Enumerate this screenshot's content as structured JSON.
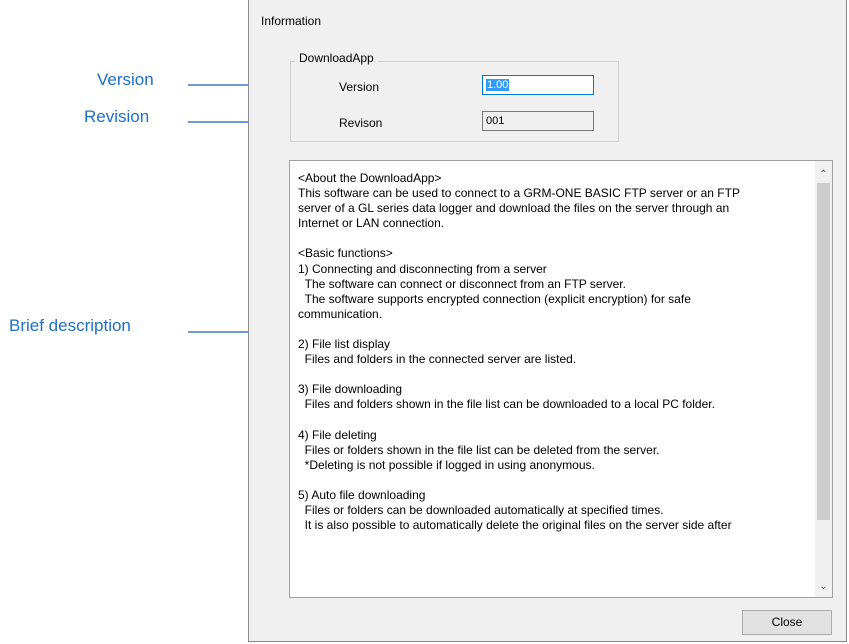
{
  "callouts": {
    "version": "Version",
    "revision": "Revision",
    "brief": "Brief description"
  },
  "dialog": {
    "title": "Information",
    "group_label": "DownloadApp",
    "version_label": "Version",
    "version_value": "1.00",
    "revision_label": "Revison",
    "revision_value": "001",
    "close_label": "Close",
    "description": "<About the DownloadApp>\nThis software can be used to connect to a GRM-ONE BASIC FTP server or an FTP\nserver of a GL series data logger and download the files on the server through an\nInternet or LAN connection.\n\n<Basic functions>\n1) Connecting and disconnecting from a server\n  The software can connect or disconnect from an FTP server.\n  The software supports encrypted connection (explicit encryption) for safe\ncommunication.\n\n2) File list display\n  Files and folders in the connected server are listed.\n\n3) File downloading\n  Files and folders shown in the file list can be downloaded to a local PC folder.\n\n4) File deleting\n  Files or folders shown in the file list can be deleted from the server.\n  *Deleting is not possible if logged in using anonymous.\n\n5) Auto file downloading\n  Files or folders can be downloaded automatically at specified times.\n  It is also possible to automatically delete the original files on the server side after",
    "scroll_up_icon": "chevron-up",
    "scroll_down_icon": "chevron-down"
  },
  "colors": {
    "callout_text": "#1f6fc5",
    "callout_line": "#6f9ad6",
    "dialog_bg": "#f0f0f0"
  }
}
